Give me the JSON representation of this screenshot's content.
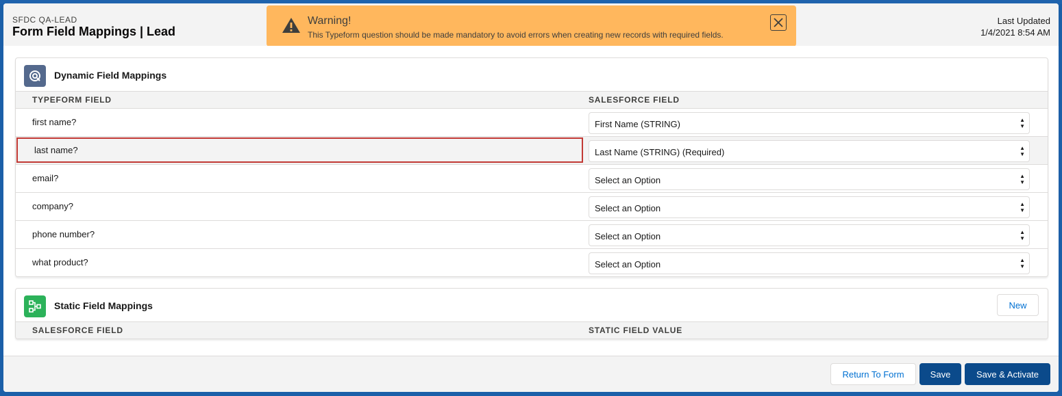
{
  "header": {
    "object_label": "SFDC QA-LEAD",
    "title": "Form Field Mappings | Lead",
    "last_updated_label": "Last Updated",
    "last_updated_value": "1/4/2021 8:54 AM"
  },
  "toast": {
    "icon": "warning-icon",
    "title": "Warning!",
    "message": "This Typeform question should be made mandatory to avoid errors when creating new records with required fields.",
    "close_icon": "close-icon",
    "color": "#ffb75d"
  },
  "dynamic": {
    "title": "Dynamic Field Mappings",
    "icon": "dynamic-mapping-icon",
    "col_typeform": "Typeform Field",
    "col_salesforce": "Salesforce Field",
    "rows": [
      {
        "typeform": "first name?",
        "salesforce": "First Name (STRING)"
      },
      {
        "typeform": "last name?",
        "salesforce": "Last Name (STRING) (Required)"
      },
      {
        "typeform": "email?",
        "salesforce": "Select an Option"
      },
      {
        "typeform": "company?",
        "salesforce": "Select an Option"
      },
      {
        "typeform": "phone number?",
        "salesforce": "Select an Option"
      },
      {
        "typeform": "what product?",
        "salesforce": "Select an Option"
      }
    ]
  },
  "static": {
    "title": "Static Field Mappings",
    "icon": "hierarchy-icon",
    "new_label": "New",
    "col_salesforce": "Salesforce Field",
    "col_value": "Static Field Value"
  },
  "footer": {
    "return_label": "Return To Form",
    "save_label": "Save",
    "save_activate_label": "Save & Activate"
  },
  "colors": {
    "brand": "#0b4a8b",
    "error_outline": "#c23934",
    "dynamic_icon_bg": "#54698d",
    "static_icon_bg": "#2cb25a"
  }
}
